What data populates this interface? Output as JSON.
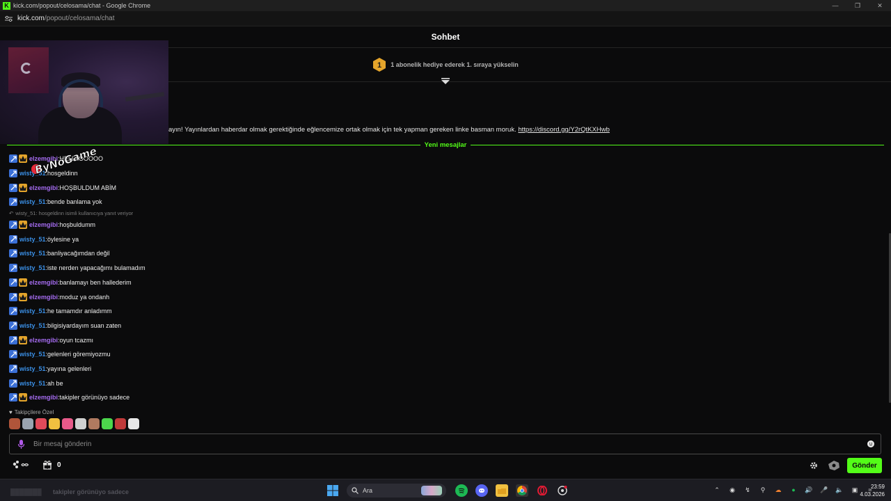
{
  "browser": {
    "title": "kick.com/popout/celosama/chat - Google Chrome",
    "logo_letter": "K",
    "url_domain": "kick.com",
    "url_path": "/popout/celosama/chat"
  },
  "chat": {
    "heading": "Sohbet",
    "subgift": {
      "rank": "1",
      "text": "1 abonelik hediye ederek 1. sıraya yükselin"
    },
    "pinned": {
      "text": "ayın! Yayınlardan haberdar olmak gerektiğinde eğlencemize ortak olmak için tek yapman gereken linke basman moruk.",
      "link": "https://discord.gg/Y2rQtKXHwb"
    },
    "new_messages_label": "Yeni mesajlar",
    "watermark": "ByNoGame",
    "messages": [
      {
        "user": "elzemgibi",
        "crown": true,
        "color": "purple",
        "text": "HELLLOOOOO"
      },
      {
        "user": "wisty_51",
        "crown": false,
        "color": "blue",
        "text": "hosgeldinn"
      },
      {
        "user": "elzemgibi",
        "crown": true,
        "color": "purple",
        "text": "HOŞBULDUM ABİM"
      },
      {
        "user": "wisty_51",
        "crown": false,
        "color": "blue",
        "text": "bende banlama yok"
      },
      {
        "reply": "wisty_51: hosgeldinn isimli kullanıcıya yanıt veriyor",
        "user": "elzemgibi",
        "crown": true,
        "color": "purple",
        "text": "hoşbuldumm"
      },
      {
        "user": "wisty_51",
        "crown": false,
        "color": "blue",
        "text": "öylesine ya"
      },
      {
        "user": "wisty_51",
        "crown": false,
        "color": "blue",
        "text": "banliyacağımdan değil"
      },
      {
        "user": "wisty_51",
        "crown": false,
        "color": "blue",
        "text": "iste nerden yapacağımı bulamadım"
      },
      {
        "user": "elzemgibi",
        "crown": true,
        "color": "purple",
        "text": "banlamayı ben hallederim"
      },
      {
        "user": "elzemgibi",
        "crown": true,
        "color": "purple",
        "text": "moduz ya ondanh"
      },
      {
        "user": "wisty_51",
        "crown": false,
        "color": "blue",
        "text": "he tamamdır anladımm"
      },
      {
        "user": "wisty_51",
        "crown": false,
        "color": "blue",
        "text": "bilgisiyardayım suan zaten"
      },
      {
        "user": "elzemgibi",
        "crown": true,
        "color": "purple",
        "text": "oyun tcazmı"
      },
      {
        "user": "wisty_51",
        "crown": false,
        "color": "blue",
        "text": "gelenleri göremiyozmu"
      },
      {
        "user": "wisty_51",
        "crown": false,
        "color": "blue",
        "text": "yayına gelenleri"
      },
      {
        "user": "wisty_51",
        "crown": false,
        "color": "blue",
        "text": "ah be"
      },
      {
        "user": "elzemgibi",
        "crown": true,
        "color": "purple",
        "text": "takipler görünüyo sadece"
      }
    ],
    "followers_only_label": "Takipçilere Özel",
    "emotes": [
      "#b0553a",
      "#9aa4b0",
      "#e24a5a",
      "#f0c040",
      "#e85a8a",
      "#d0d0d0",
      "#b07a60",
      "#4cd64c",
      "#c03a3a",
      "#e8e8e8"
    ],
    "input": {
      "placeholder": "Bir mesaj gönderin",
      "value": ""
    },
    "gift_count": "0",
    "send_label": "Gönder"
  },
  "taskbar": {
    "ghost_message": "takipler görünüyo sadece",
    "search_label": "Ara",
    "time": "23:59",
    "date": "4.03.2026"
  },
  "colors": {
    "accent": "#53fc18",
    "purple_user": "#a56cf0",
    "blue_user": "#3a8fe6"
  }
}
